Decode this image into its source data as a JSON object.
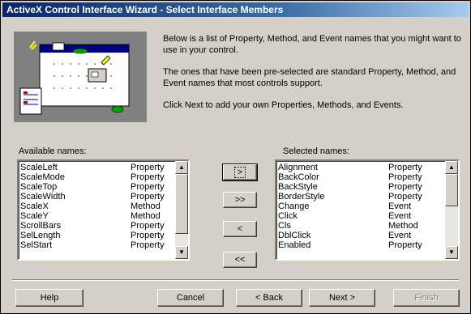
{
  "window": {
    "title": "ActiveX Control Interface Wizard - Select Interface Members"
  },
  "intro": {
    "p1": "Below is a list of Property, Method, and Event names that you might want to use in your control.",
    "p2": "The ones that have been pre-selected are standard Property, Method, and Event names that most controls support.",
    "p3": "Click Next to add your own Properties, Methods, and Events."
  },
  "available": {
    "label": "Available names:",
    "items": [
      {
        "name": "ScaleLeft",
        "type": "Property"
      },
      {
        "name": "ScaleMode",
        "type": "Property"
      },
      {
        "name": "ScaleTop",
        "type": "Property"
      },
      {
        "name": "ScaleWidth",
        "type": "Property"
      },
      {
        "name": "ScaleX",
        "type": "Method"
      },
      {
        "name": "ScaleY",
        "type": "Method"
      },
      {
        "name": "ScrollBars",
        "type": "Property"
      },
      {
        "name": "SelLength",
        "type": "Property"
      },
      {
        "name": "SelStart",
        "type": "Property"
      }
    ]
  },
  "selected": {
    "label": "Selected names:",
    "items": [
      {
        "name": "Alignment",
        "type": "Property"
      },
      {
        "name": "BackColor",
        "type": "Property"
      },
      {
        "name": "BackStyle",
        "type": "Property"
      },
      {
        "name": "BorderStyle",
        "type": "Property"
      },
      {
        "name": "Change",
        "type": "Event"
      },
      {
        "name": "Click",
        "type": "Event"
      },
      {
        "name": "Cls",
        "type": "Method"
      },
      {
        "name": "DblClick",
        "type": "Event"
      },
      {
        "name": "Enabled",
        "type": "Property"
      }
    ]
  },
  "transfer": {
    "add_one": ">",
    "add_all": ">>",
    "remove_one": "<",
    "remove_all": "<<"
  },
  "footer": {
    "help": "Help",
    "cancel": "Cancel",
    "back": "< Back",
    "next": "Next >",
    "finish": "Finish"
  },
  "colors": {
    "titlebar_start": "#0a246a",
    "titlebar_end": "#a6caf0",
    "face": "#d4d0c8"
  }
}
